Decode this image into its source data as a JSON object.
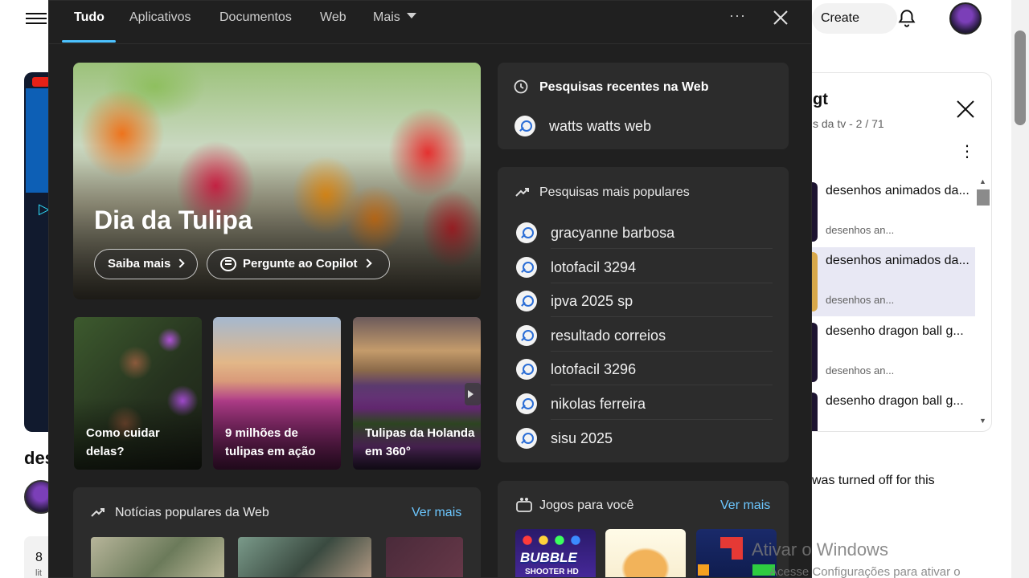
{
  "youtube": {
    "create_label": "Create",
    "video_title_fragment": "des",
    "likes_fragment": "8",
    "likes_sub_fragment": "lit",
    "playlist": {
      "title_fragment": "gt",
      "subtitle_fragment": "s da tv - 2 / 71",
      "items": [
        {
          "title": "desenhos animados da...",
          "meta": "desenhos an..."
        },
        {
          "title": "desenhos animados da...",
          "meta": "desenhos an..."
        },
        {
          "title": "desenho dragon ball g...",
          "meta": "desenhos an..."
        },
        {
          "title": "desenho dragon ball g...",
          "meta": ""
        }
      ]
    },
    "turned_off_fragment": "was turned off for this"
  },
  "flyout": {
    "tabs": [
      "Tudo",
      "Aplicativos",
      "Documentos",
      "Web",
      "Mais"
    ],
    "more_glyph": "···",
    "hero": {
      "title": "Dia da Tulipa",
      "learn_more": "Saiba mais",
      "ask_copilot": "Pergunte ao Copilot"
    },
    "tiles": [
      "Como cuidar delas?",
      "9 milhões de tulipas em ação",
      "Tulipas da Holanda em 360°"
    ],
    "news": {
      "title": "Notícias populares da Web",
      "see_more": "Ver mais"
    },
    "recent": {
      "title": "Pesquisas recentes na Web",
      "items": [
        "watts watts web"
      ]
    },
    "popular": {
      "title": "Pesquisas mais populares",
      "items": [
        "gracyanne barbosa",
        "lotofacil 3294",
        "ipva 2025 sp",
        "resultado correios",
        "lotofacil 3296",
        "nikolas ferreira",
        "sisu 2025"
      ]
    },
    "games": {
      "title": "Jogos para você",
      "see_more": "Ver mais",
      "bubble_title": "BUBBLE",
      "bubble_sub": "SHOOTER HD"
    }
  },
  "activation": {
    "title": "Ativar o Windows",
    "subtitle": "Acesse Configurações para ativar o"
  }
}
